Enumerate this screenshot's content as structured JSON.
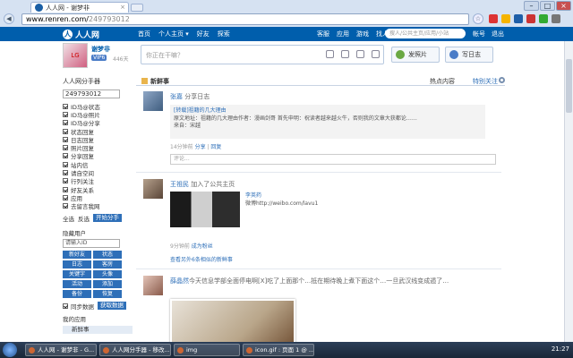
{
  "browser": {
    "tab_title": "人人网 - 谢梦非",
    "url_host": "www.renren.com/",
    "url_path": "249793012"
  },
  "site": {
    "logo_text": "人人网",
    "nav": [
      "首页",
      "个人主页 ▾",
      "好友",
      "探索"
    ],
    "right_nav": [
      "客服",
      "应用",
      "游戏",
      "找人"
    ],
    "search_placeholder": "搜人/公共主页/应用/小站",
    "account": [
      "帐号",
      "退出"
    ]
  },
  "profile": {
    "name": "谢梦非",
    "vip": "VIP6",
    "days": "446天"
  },
  "composer": {
    "placeholder": "你正在干嘛？",
    "photo_btn": "发照片",
    "diary_btn": "写日志"
  },
  "sidebar": {
    "title": "人人网分手器",
    "uid": "249793012",
    "options": [
      "ID马@状态",
      "ID马@照片",
      "ID马@分享",
      "状态回复",
      "日志回复",
      "照片回复",
      "分享回复",
      "站内信",
      "请自空间",
      "行列关注",
      "好友关系",
      "应用",
      "去留言我网"
    ],
    "select_all": "全选",
    "invert": "反选",
    "go_button": "开始分手",
    "group_label": "隐藏用户",
    "id_placeholder": "请输入ID",
    "grid_buttons": [
      "新好友",
      "状态",
      "日志",
      "客房",
      "关键字",
      "头像",
      "活动",
      "添加",
      "备份",
      "恢复"
    ],
    "sync_label": "同步数据",
    "sync_button": "获取数据",
    "my_apps": "我的应用",
    "feed_tab": "新鲜事"
  },
  "feed": {
    "title": "新鲜事",
    "tab_hot": "热点内容",
    "tab_special": "特别关注",
    "posts": [
      {
        "name": "张嘉",
        "action": "分享日志",
        "quote_title": "[转载]祖籍的几大理由",
        "quote_body": "原文地址：祖籍的几大理由作者：漫画剑哥 首先申明：祝读者越来越火牛，否则我的文章大获都论……",
        "quote_from": "来自：宋越",
        "meta_time": "14分钟前",
        "meta_share": "分享",
        "meta_reply": "回复",
        "comment_placeholder": "评论..."
      },
      {
        "name": "王祖民",
        "action": "加入了公共主页",
        "share_name": "李英药",
        "share_link": "微博http://weibo.com/lavu1",
        "meta_time": "9分钟前",
        "meta_like": "成为粉丝",
        "more": "查看另外6条相似的新鲜事"
      },
      {
        "name": "薛晶然",
        "text": "今天信息学部全面停电啊[X]吃了上面那个…抵在期待晚上煮下面这个…一旦武汉线变成遁了…"
      }
    ]
  },
  "taskbar": {
    "tasks": [
      "人人网 - 谢梦非 - G...",
      "人人网分手器 - 移改...",
      "img",
      "icon.gif : 页面 1 @ ..."
    ],
    "clock": "21:27"
  }
}
